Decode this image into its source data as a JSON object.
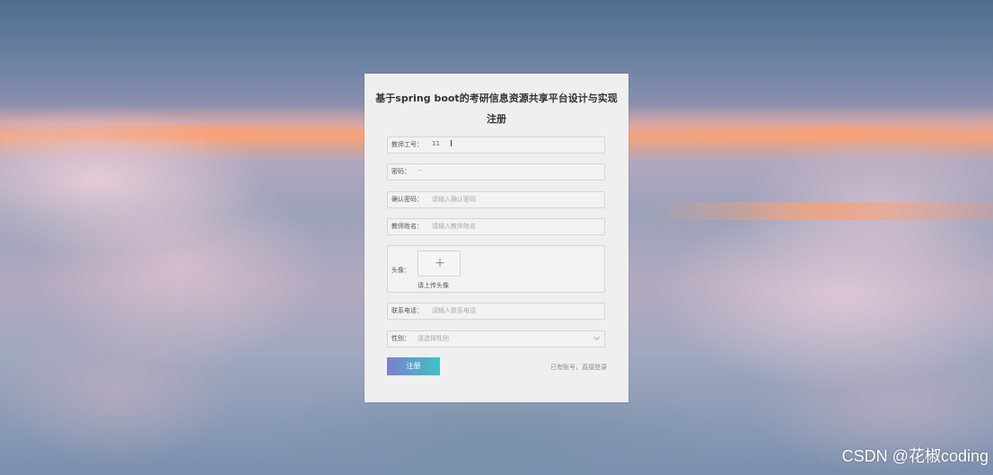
{
  "form": {
    "title": "基于spring boot的考研信息资源共享平台设计与实现注册",
    "fields": {
      "teacher_id": {
        "label": "教师工号：",
        "value": "11"
      },
      "password": {
        "label": "密码：",
        "value": "··"
      },
      "confirm_password": {
        "label": "确认密码：",
        "placeholder": "请输入确认密码"
      },
      "teacher_name": {
        "label": "教师姓名：",
        "placeholder": "请输入教师姓名"
      },
      "avatar": {
        "label": "头像：",
        "plus": "+",
        "tip": "请上传头像"
      },
      "phone": {
        "label": "联系电话：",
        "placeholder": "请输入联系电话"
      },
      "gender": {
        "label": "性别：",
        "placeholder": "请选择性别"
      }
    },
    "register_button": "注册",
    "login_link": "已有账号，直接登录"
  },
  "watermark": "CSDN @花椒coding",
  "colors": {
    "button_gradient_start": "#7a7fd0",
    "button_gradient_end": "#3ec3c4",
    "panel_bg": "#efefef"
  },
  "icons": {
    "cursor": "text-cursor-icon",
    "upload": "plus-icon",
    "select": "chevron-down-icon"
  }
}
